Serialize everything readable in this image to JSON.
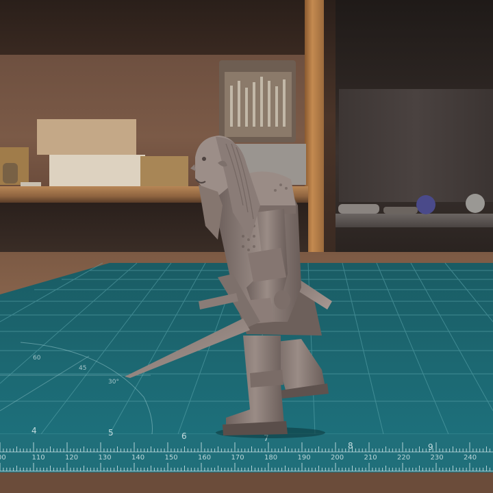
{
  "scene": {
    "subject": "painted-unpainted fantasy miniature",
    "colors": {
      "mat": "#1f6f78",
      "mat_dark": "#175a62",
      "grid_line": "#5fa9b0",
      "miniature": "#8a7d78",
      "wood": "#8c6850"
    }
  },
  "mat": {
    "cm_labels": [
      "00",
      "110",
      "120",
      "130",
      "140",
      "150",
      "160",
      "170",
      "180",
      "190",
      "200",
      "210",
      "220",
      "230",
      "240"
    ],
    "inch_labels": [
      "4",
      "5",
      "6",
      "7",
      "8",
      "9"
    ],
    "angle_labels": [
      "60",
      "45",
      "30°"
    ]
  }
}
